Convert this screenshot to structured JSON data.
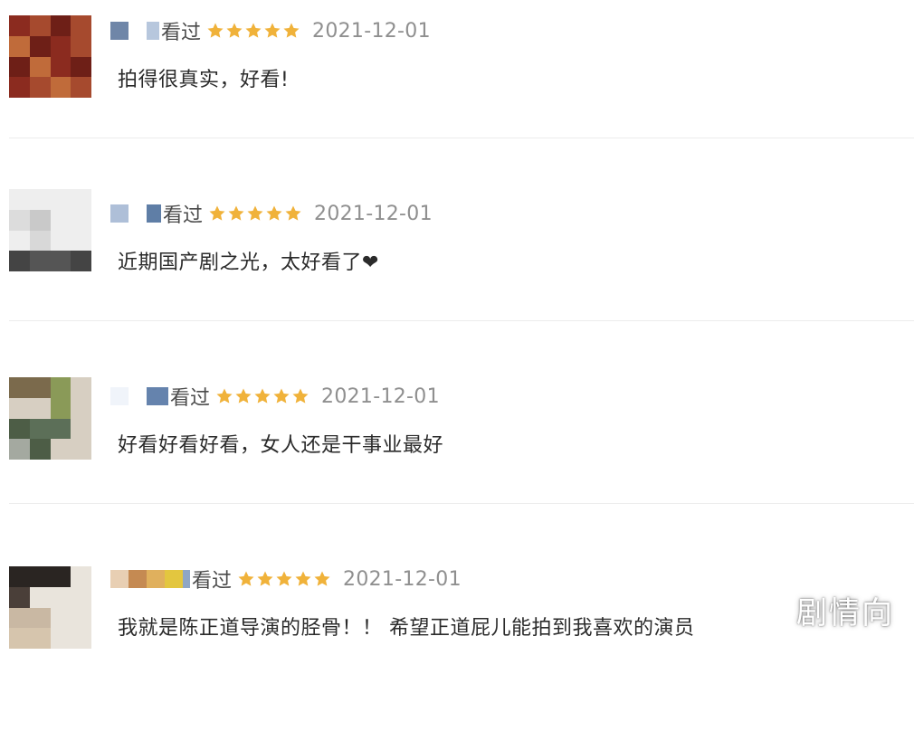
{
  "reviews": [
    {
      "watched_label": "看过",
      "rating_stars": 5,
      "date": "2021-12-01",
      "comment": "拍得很真实，好看!",
      "avatar_icon": "blurred-avatar-icon",
      "name_block_colors": [
        "#6f86a8",
        "#ffffff",
        "#b7c7dd"
      ]
    },
    {
      "watched_label": "看过",
      "rating_stars": 5,
      "date": "2021-12-01",
      "comment": "近期国产剧之光，太好看了❤",
      "avatar_icon": "blurred-avatar-icon",
      "name_block_colors": [
        "#aebfd8",
        "#ffffff",
        "#5f7ea6"
      ]
    },
    {
      "watched_label": "看过",
      "rating_stars": 5,
      "date": "2021-12-01",
      "comment": "好看好看好看，女人还是干事业最好",
      "avatar_icon": "blurred-avatar-icon",
      "name_block_colors": [
        "#f0f4fa",
        "#ffffff",
        "#6583ad"
      ]
    },
    {
      "watched_label": "看过",
      "rating_stars": 5,
      "date": "2021-12-01",
      "comment": "我就是陈正道导演的胫骨！！ 希望正道屁儿能拍到我喜欢的演员",
      "avatar_icon": "blurred-avatar-icon",
      "name_block_colors": [
        "#e8cfb3",
        "#c58a52",
        "#e0b05d",
        "#e3c63f",
        "#8fa6c5"
      ]
    }
  ],
  "watermark": "剧情向",
  "colors": {
    "star": "#f0b23a",
    "date": "#8f8f8f",
    "divider": "#ececec"
  }
}
